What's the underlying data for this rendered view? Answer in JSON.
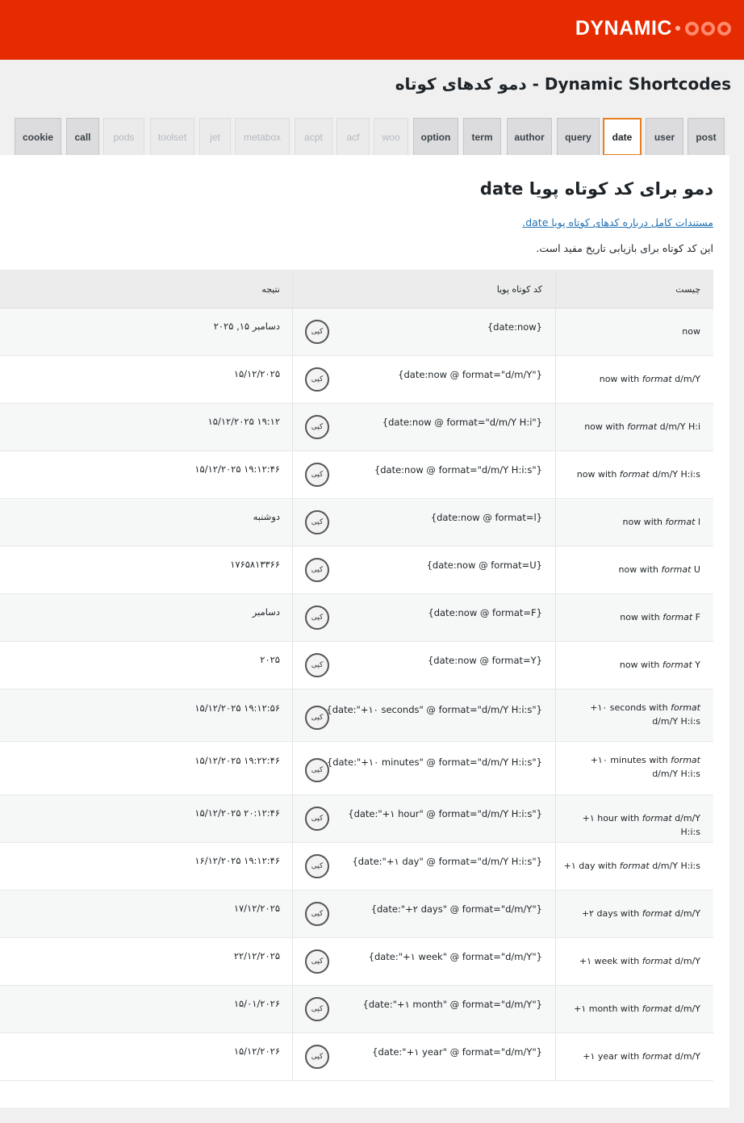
{
  "header": {
    "logo_text": "DYNAMIC",
    "page_title": "Dynamic Shortcodes - دمو کدهای کوتاه"
  },
  "tabs": [
    {
      "label": "cookie",
      "state": "normal"
    },
    {
      "label": "call",
      "state": "normal"
    },
    {
      "label": "pods",
      "state": "disabled"
    },
    {
      "label": "toolset",
      "state": "disabled"
    },
    {
      "label": "jet",
      "state": "disabled"
    },
    {
      "label": "metabox",
      "state": "disabled"
    },
    {
      "label": "acpt",
      "state": "disabled"
    },
    {
      "label": "acf",
      "state": "disabled"
    },
    {
      "label": "woo",
      "state": "disabled"
    },
    {
      "label": "option",
      "state": "normal"
    },
    {
      "label": "term",
      "state": "normal"
    },
    {
      "label": "author",
      "state": "normal"
    },
    {
      "label": "query",
      "state": "normal"
    },
    {
      "label": "date",
      "state": "active"
    },
    {
      "label": "user",
      "state": "normal"
    },
    {
      "label": "post",
      "state": "normal"
    }
  ],
  "section": {
    "title": "دمو برای کد کوتاه پویا date",
    "doc_link": "مستندات کامل درباره کدهای کوتاه پویا date.",
    "description": "این کد کوتاه برای بازیابی تاریخ مفید است."
  },
  "table": {
    "headers": {
      "what": "چیست",
      "code": "کد کوتاه پویا",
      "result": "نتیجه"
    },
    "copy_label": "کپی",
    "rows": [
      {
        "what_pre": "now",
        "what_fmt": "",
        "what_post": "",
        "code": "{date:now}",
        "result": "دسامبر ۱۵, ۲۰۲۵"
      },
      {
        "what_pre": "now with ",
        "what_fmt": "format",
        "what_post": " d/m/Y",
        "code": "{date:now @ format=\"d/m/Y\"}",
        "result": "۱۵/۱۲/۲۰۲۵"
      },
      {
        "what_pre": "now with ",
        "what_fmt": "format",
        "what_post": " d/m/Y H:i",
        "code": "{date:now @ format=\"d/m/Y H:i\"}",
        "result": "۱۵/۱۲/۲۰۲۵ ۱۹:۱۲"
      },
      {
        "what_pre": "now with ",
        "what_fmt": "format",
        "what_post": " d/m/Y H:i:s",
        "code": "{date:now @ format=\"d/m/Y H:i:s\"}",
        "result": "۱۵/۱۲/۲۰۲۵ ۱۹:۱۲:۴۶"
      },
      {
        "what_pre": "now with ",
        "what_fmt": "format",
        "what_post": " l",
        "code": "{date:now @ format=l}",
        "result": "دوشنبه"
      },
      {
        "what_pre": "now with ",
        "what_fmt": "format",
        "what_post": " U",
        "code": "{date:now @ format=U}",
        "result": "۱۷۶۵۸۱۳۳۶۶"
      },
      {
        "what_pre": "now with ",
        "what_fmt": "format",
        "what_post": " F",
        "code": "{date:now @ format=F}",
        "result": "دسامبر"
      },
      {
        "what_pre": "now with ",
        "what_fmt": "format",
        "what_post": " Y",
        "code": "{date:now @ format=Y}",
        "result": "۲۰۲۵"
      },
      {
        "what_pre": "+۱۰ seconds with ",
        "what_fmt": "format",
        "what_post": " d/m/Y H:i:s",
        "code": "{date:\"+۱۰ seconds\" @ format=\"d/m/Y H:i:s\"}",
        "result": "۱۵/۱۲/۲۰۲۵ ۱۹:۱۲:۵۶"
      },
      {
        "what_pre": "+۱۰ minutes with ",
        "what_fmt": "format",
        "what_post": " d/m/Y H:i:s",
        "code": "{date:\"+۱۰ minutes\" @ format=\"d/m/Y H:i:s\"}",
        "result": "۱۵/۱۲/۲۰۲۵ ۱۹:۲۲:۴۶"
      },
      {
        "what_pre": "+۱ hour with ",
        "what_fmt": "format",
        "what_post": " d/m/Y H:i:s",
        "code": "{date:\"+۱ hour\" @ format=\"d/m/Y H:i:s\"}",
        "result": "۱۵/۱۲/۲۰۲۵ ۲۰:۱۲:۴۶"
      },
      {
        "what_pre": "+۱ day with ",
        "what_fmt": "format",
        "what_post": " d/m/Y H:i:s",
        "code": "{date:\"+۱ day\" @ format=\"d/m/Y H:i:s\"}",
        "result": "۱۶/۱۲/۲۰۲۵ ۱۹:۱۲:۴۶"
      },
      {
        "what_pre": "+۲ days with ",
        "what_fmt": "format",
        "what_post": " d/m/Y",
        "code": "{date:\"+۲ days\" @ format=\"d/m/Y\"}",
        "result": "۱۷/۱۲/۲۰۲۵"
      },
      {
        "what_pre": "+۱ week with ",
        "what_fmt": "format",
        "what_post": " d/m/Y",
        "code": "{date:\"+۱ week\" @ format=\"d/m/Y\"}",
        "result": "۲۲/۱۲/۲۰۲۵"
      },
      {
        "what_pre": "+۱ month with ",
        "what_fmt": "format",
        "what_post": " d/m/Y",
        "code": "{date:\"+۱ month\" @ format=\"d/m/Y\"}",
        "result": "۱۵/۰۱/۲۰۲۶"
      },
      {
        "what_pre": "+۱ year with ",
        "what_fmt": "format",
        "what_post": " d/m/Y",
        "code": "{date:\"+۱ year\" @ format=\"d/m/Y\"}",
        "result": "۱۵/۱۲/۲۰۲۶"
      }
    ]
  }
}
